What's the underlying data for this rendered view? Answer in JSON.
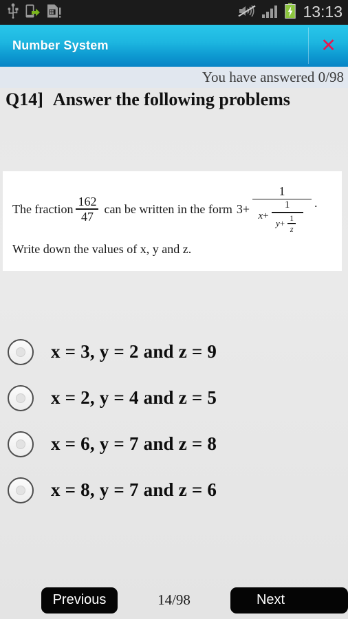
{
  "status_bar": {
    "icons": [
      "usb-icon",
      "phone-transfer-icon",
      "sim-card-icon"
    ],
    "right_icons": [
      "mute-icon",
      "signal-bars-icon",
      "battery-charging-icon"
    ],
    "clock": "13:13",
    "background": "#1b1b1b",
    "battery_color": "#8cc63e"
  },
  "action_bar": {
    "title": "Number System",
    "close_label": "✕",
    "gradient_top": "#29c6ea",
    "gradient_bottom": "#0784c6"
  },
  "progress": {
    "answered_text": "You have answered 0/98",
    "band_color": "#e1e7ef"
  },
  "question": {
    "number_label": "Q14]",
    "instruction": "Answer the following problems",
    "statement_prefix": "The fraction",
    "fraction_numerator": "162",
    "fraction_denominator": "47",
    "statement_middle": "can be written in the form",
    "leading_term": "3+",
    "cf_num1": "1",
    "cf_var_x": "x",
    "cf_plus1": "+",
    "cf_num2": "1",
    "cf_var_y": "y",
    "cf_plus2": "+",
    "cf_num3": "1",
    "cf_var_z": "z",
    "trailing_period": ".",
    "statement_second_line": "Write down the values of x, y and z."
  },
  "options": [
    {
      "id": "option-a",
      "label": "x = 3, y = 2 and z = 9",
      "selected": false
    },
    {
      "id": "option-b",
      "label": "x = 2, y = 4 and z = 5",
      "selected": false
    },
    {
      "id": "option-c",
      "label": "x = 6, y = 7 and z = 8",
      "selected": false
    },
    {
      "id": "option-d",
      "label": "x = 8, y = 7 and z = 6",
      "selected": false
    }
  ],
  "bottom_nav": {
    "previous_label": "Previous",
    "counter": "14/98",
    "next_label": "Next"
  }
}
